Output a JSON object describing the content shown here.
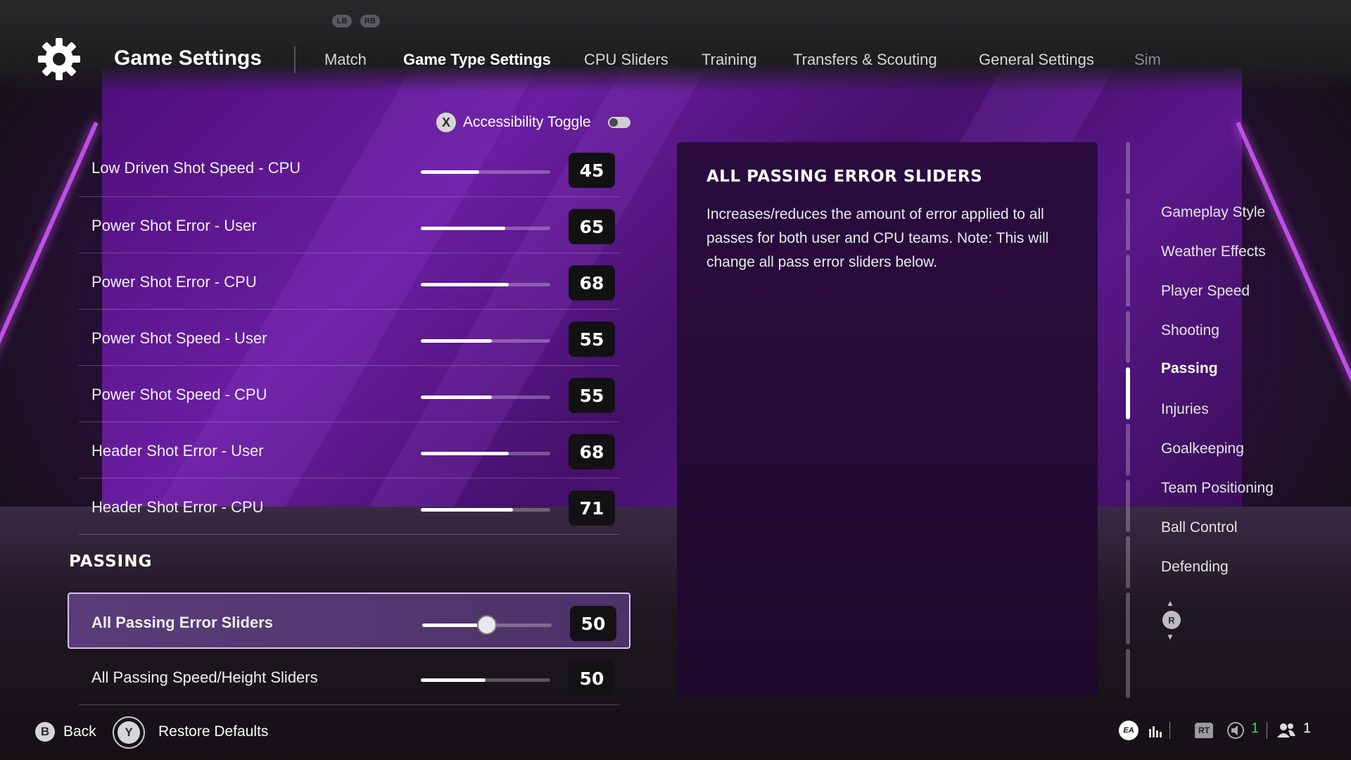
{
  "header": {
    "title": "Game Settings",
    "lb_label": "LB",
    "rb_label": "RB",
    "tabs": [
      {
        "label": "Match"
      },
      {
        "label": "Game Type Settings"
      },
      {
        "label": "CPU Sliders"
      },
      {
        "label": "Training"
      },
      {
        "label": "Transfers & Scouting"
      },
      {
        "label": "General Settings"
      },
      {
        "label": "Sim"
      }
    ],
    "active_tab": "Game Type Settings"
  },
  "accessibility": {
    "button": "X",
    "label": "Accessibility Toggle",
    "enabled": false
  },
  "sliders": [
    {
      "label": "Low Driven Shot Speed - CPU",
      "value": "45"
    },
    {
      "label": "Power Shot Error - User",
      "value": "65"
    },
    {
      "label": "Power Shot Error - CPU",
      "value": "68"
    },
    {
      "label": "Power Shot Speed - User",
      "value": "55"
    },
    {
      "label": "Power Shot Speed - CPU",
      "value": "55"
    },
    {
      "label": "Header Shot Error - User",
      "value": "68"
    },
    {
      "label": "Header Shot Error - CPU",
      "value": "71"
    }
  ],
  "section": {
    "title": "PASSING"
  },
  "passing_sliders": [
    {
      "label": "All Passing Error Sliders",
      "value": "50",
      "selected": true
    },
    {
      "label": "All Passing Speed/Height Sliders",
      "value": "50",
      "selected": false
    }
  ],
  "slider_max": 100,
  "description": {
    "title": "ALL PASSING ERROR SLIDERS",
    "body": "Increases/reduces the amount of error applied to all passes for both user and CPU teams. Note: This will change all pass error sliders below."
  },
  "nav": {
    "items": [
      {
        "label": "Gameplay Style"
      },
      {
        "label": "Weather Effects"
      },
      {
        "label": "Player Speed"
      },
      {
        "label": "Shooting"
      },
      {
        "label": "Passing"
      },
      {
        "label": "Injuries"
      },
      {
        "label": "Goalkeeping"
      },
      {
        "label": "Team Positioning"
      },
      {
        "label": "Ball Control"
      },
      {
        "label": "Defending"
      }
    ],
    "active": "Passing",
    "stick_label": "R"
  },
  "footer": {
    "back_button": "B",
    "back_label": "Back",
    "restore_button": "Y",
    "restore_label": "Restore Defaults",
    "ea_label": "EA",
    "rt_label": "RT",
    "voice_count": "1",
    "friends_count": "1"
  },
  "colors": {
    "accent_purple": "#6a1ea1",
    "neon": "#c04ee8",
    "online_green": "#4ad04a"
  }
}
